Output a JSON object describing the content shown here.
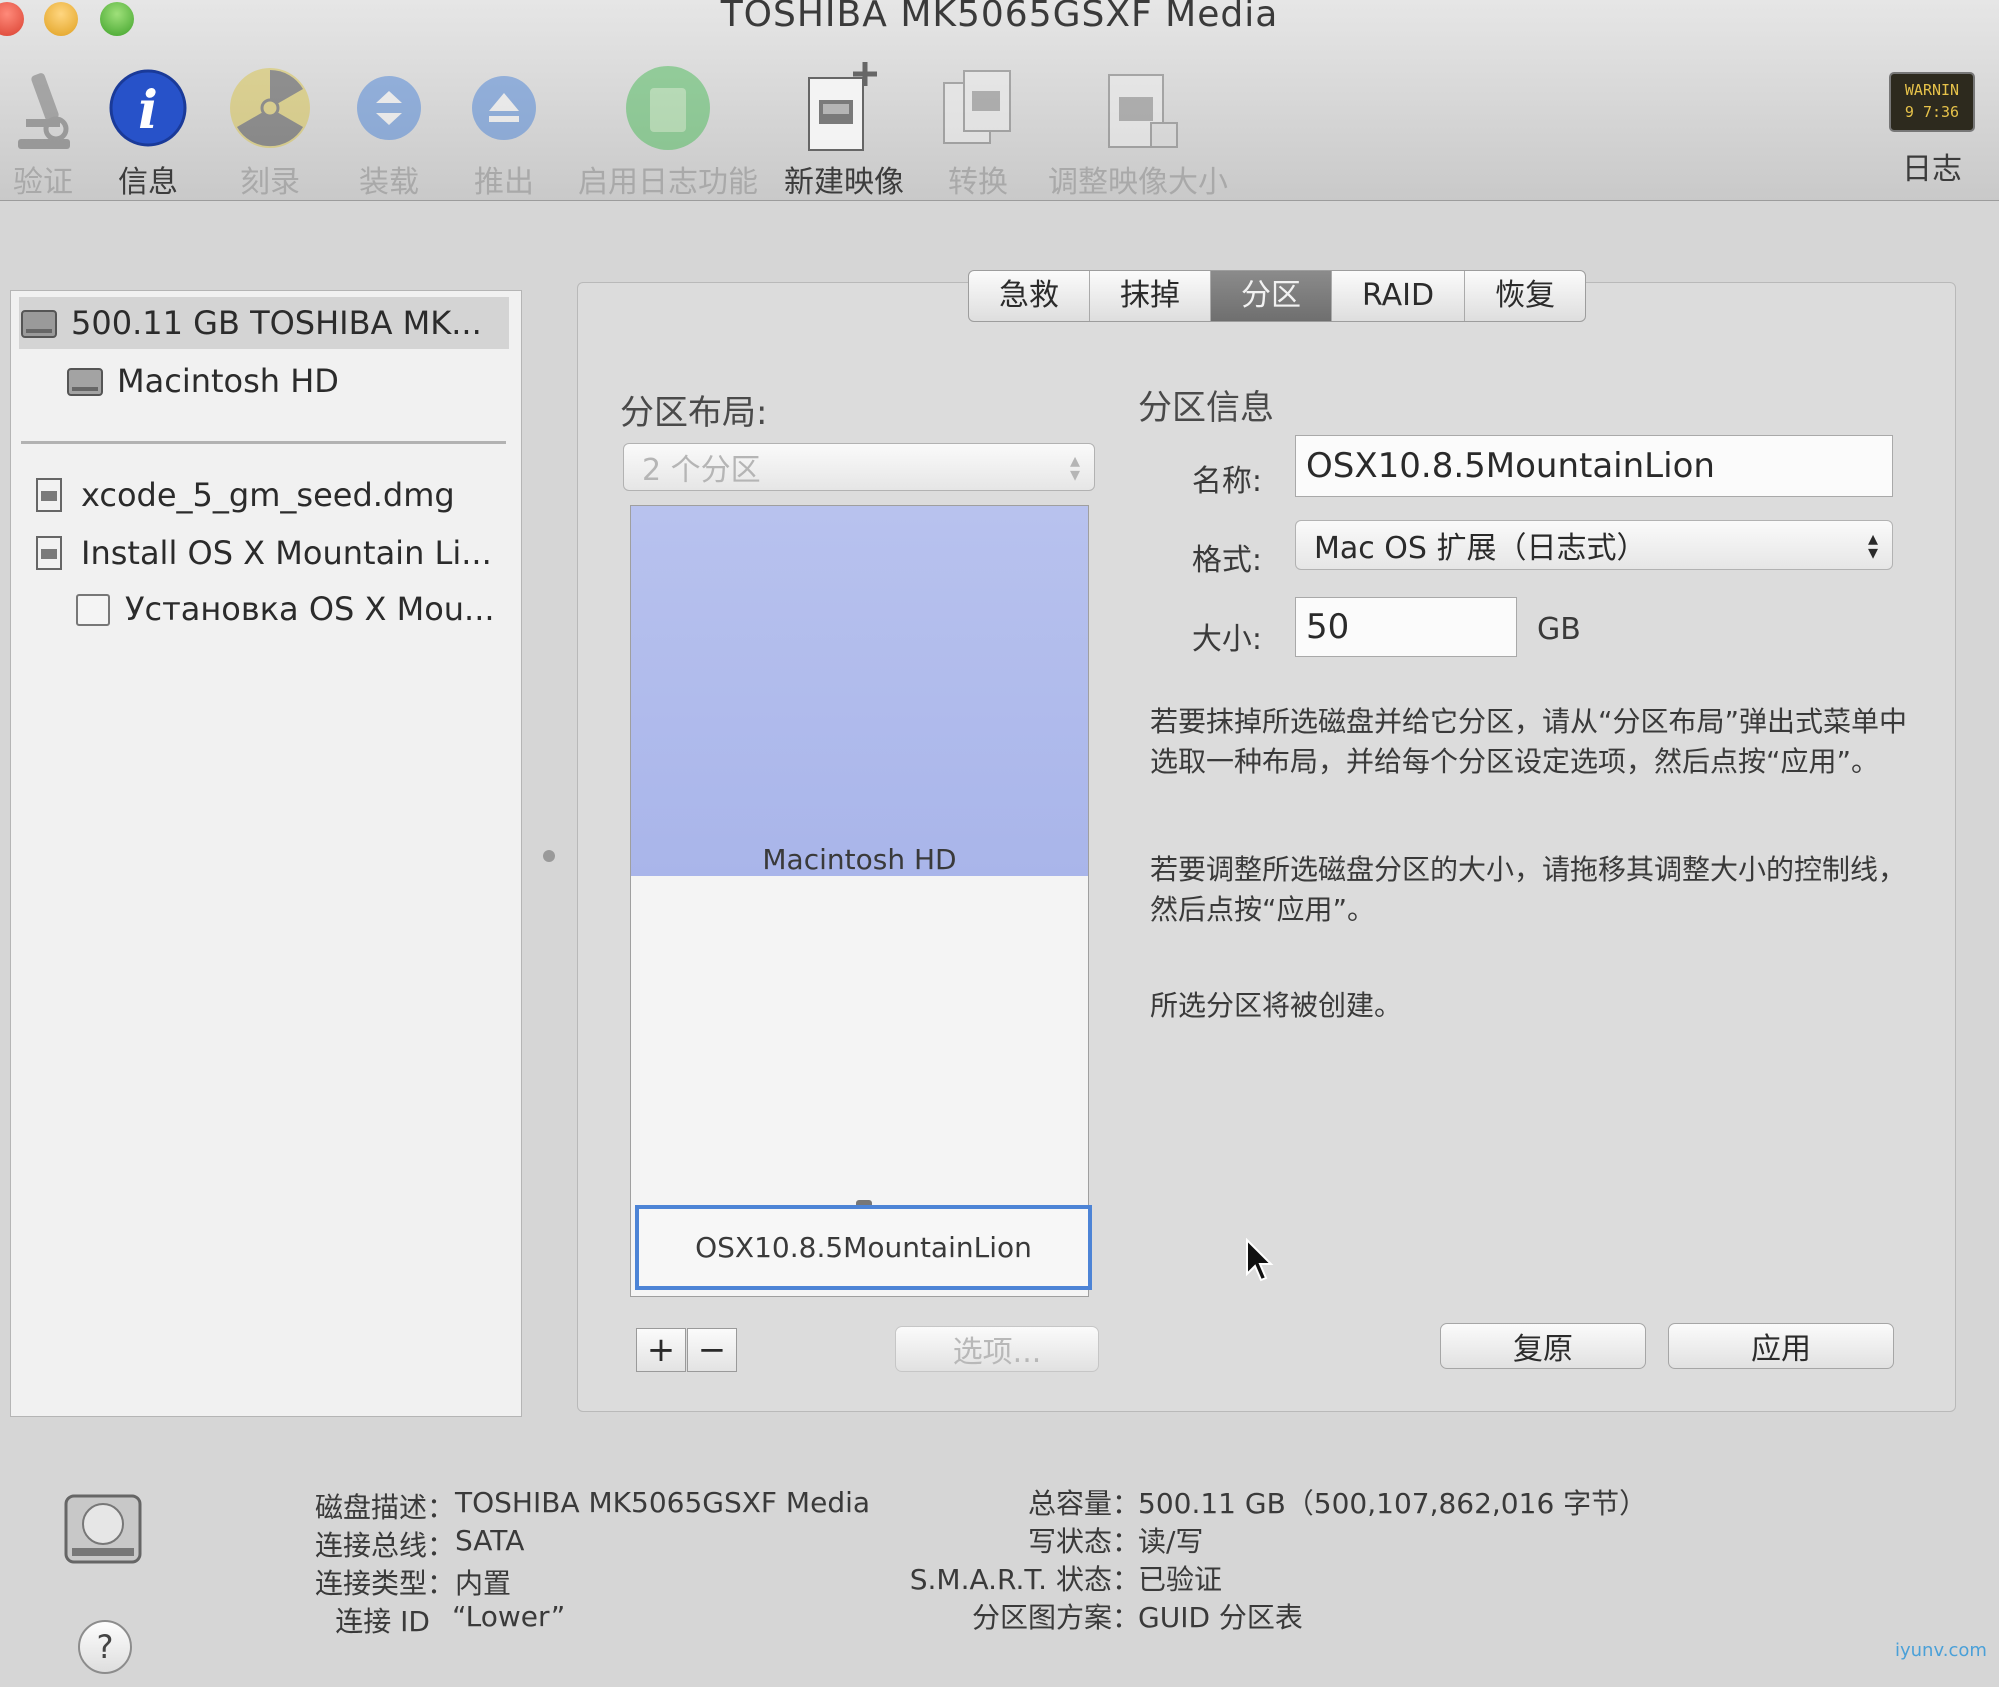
{
  "window": {
    "title": "TOSHIBA MK5065GSXF Media"
  },
  "toolbar": {
    "items": [
      {
        "label": "验证",
        "icon": "microscope-icon",
        "enabled": false
      },
      {
        "label": "信息",
        "icon": "info-icon",
        "enabled": true
      },
      {
        "label": "刻录",
        "icon": "burn-icon",
        "enabled": false
      },
      {
        "label": "装载",
        "icon": "mount-icon",
        "enabled": false
      },
      {
        "label": "推出",
        "icon": "eject-icon",
        "enabled": false
      },
      {
        "label": "启用日志功能",
        "icon": "journal-icon",
        "enabled": false
      },
      {
        "label": "新建映像",
        "icon": "new-image-icon",
        "enabled": true
      },
      {
        "label": "转换",
        "icon": "convert-icon",
        "enabled": false
      },
      {
        "label": "调整映像大小",
        "icon": "resize-image-icon",
        "enabled": false
      }
    ],
    "log": {
      "label": "日志",
      "icon_text": "WARNIN\n9 7:36"
    }
  },
  "sidebar": {
    "disks": [
      {
        "label": "500.11 GB TOSHIBA MK...",
        "level": 0,
        "selected": true
      },
      {
        "label": "Macintosh HD",
        "level": 1
      }
    ],
    "images": [
      {
        "label": "xcode_5_gm_seed.dmg",
        "level": 0
      },
      {
        "label": "Install OS X Mountain Li...",
        "level": 0
      },
      {
        "label": "Установка OS X Mou...",
        "level": 1
      }
    ]
  },
  "tabs": [
    {
      "label": "急救",
      "active": false
    },
    {
      "label": "抹掉",
      "active": false
    },
    {
      "label": "分区",
      "active": true
    },
    {
      "label": "RAID",
      "active": false
    },
    {
      "label": "恢复",
      "active": false
    }
  ],
  "layout_section": {
    "title": "分区布局:",
    "scheme": "2 个分区",
    "partitions": [
      {
        "name": "Macintosh HD",
        "color": "#aeb8ec"
      },
      {
        "name": "OSX10.8.5MountainLion",
        "selected": true
      }
    ],
    "add_label": "+",
    "remove_label": "−",
    "options_label": "选项..."
  },
  "info_section": {
    "title": "分区信息",
    "name_label": "名称:",
    "name_value": "OSX10.8.5MountainLion",
    "format_label": "格式:",
    "format_value": "Mac OS 扩展（日志式）",
    "size_label": "大小:",
    "size_value": "50",
    "size_unit": "GB",
    "note1": "若要抹掉所选磁盘并给它分区，请从“分区布局”弹出式菜单中选取一种布局，并给每个分区设定选项，然后点按“应用”。",
    "note2": "若要调整所选磁盘分区的大小，请拖移其调整大小的控制线，然后点按“应用”。",
    "note3": "所选分区将被创建。",
    "revert_label": "复原",
    "apply_label": "应用"
  },
  "disk_info": {
    "left": [
      {
        "key": "磁盘描述：",
        "value": "TOSHIBA MK5065GSXF Media"
      },
      {
        "key": "连接总线：",
        "value": "SATA"
      },
      {
        "key": "连接类型：",
        "value": "内置"
      },
      {
        "key": "连接 ID",
        "value": "“Lower”"
      }
    ],
    "right": [
      {
        "key": "总容量：",
        "value": "500.11 GB（500,107,862,016 字节）"
      },
      {
        "key": "写状态：",
        "value": "读/写"
      },
      {
        "key": "S.M.A.R.T. 状态：",
        "value": "已验证"
      },
      {
        "key": "分区图方案：",
        "value": "GUID 分区表"
      }
    ],
    "help_label": "?"
  },
  "watermark": "iyunv.com"
}
